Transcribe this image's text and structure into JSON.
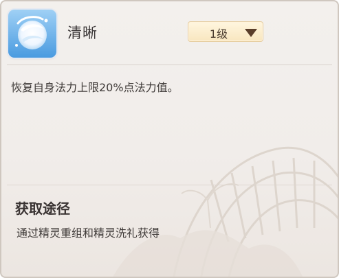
{
  "skill": {
    "name": "清晰",
    "icon": "swirl-orb-icon"
  },
  "level": {
    "selected": "1级"
  },
  "description": "恢复自身法力上限20%点法力值。",
  "source": {
    "title": "获取途径",
    "text": "通过精灵重组和精灵洗礼获得"
  },
  "colors": {
    "panel_bg": "#f1edea",
    "level_bg": "#fbecc9",
    "text": "#3f3a38"
  }
}
